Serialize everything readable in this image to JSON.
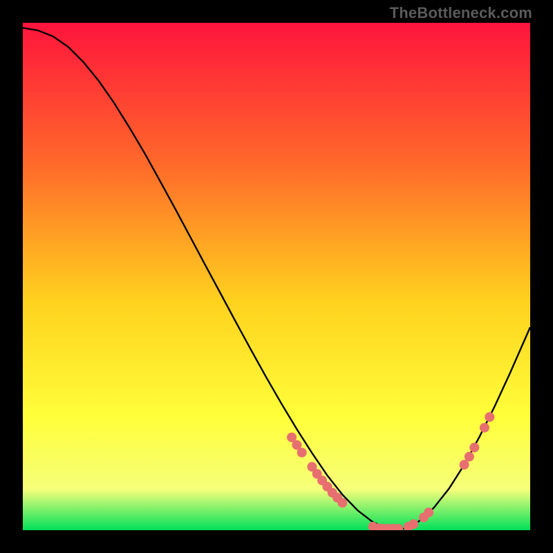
{
  "watermark": "TheBottleneck.com",
  "colors": {
    "bg": "#000000",
    "curve": "#000000",
    "marker": "#e76f6f",
    "gradient_top": "#ff143c",
    "gradient_mid_upper": "#ff6a2a",
    "gradient_mid": "#ffd21e",
    "gradient_mid_lower": "#ffff3a",
    "gradient_lower": "#f5ff7a",
    "gradient_bottom": "#00e05a"
  },
  "chart_data": {
    "type": "line",
    "title": "",
    "xlabel": "",
    "ylabel": "",
    "xlim": [
      0,
      100
    ],
    "ylim": [
      0,
      100
    ],
    "x": [
      0,
      3,
      6,
      9,
      12,
      15,
      18,
      21,
      24,
      27,
      30,
      33,
      36,
      39,
      42,
      45,
      48,
      51,
      54,
      57,
      60,
      63,
      66,
      69,
      72,
      75,
      78,
      81,
      84,
      87,
      90,
      93,
      96,
      100
    ],
    "values": [
      99,
      98.5,
      97.3,
      95.2,
      92.2,
      88.5,
      84.2,
      79.4,
      74.3,
      68.9,
      63.4,
      57.8,
      52.2,
      46.6,
      41.0,
      35.5,
      30.1,
      24.9,
      19.9,
      15.2,
      10.8,
      7.0,
      3.9,
      1.6,
      0.3,
      0.3,
      1.7,
      4.4,
      8.2,
      12.9,
      18.4,
      24.4,
      30.9,
      40.0
    ],
    "markers_x": [
      53,
      54,
      55,
      57,
      58,
      59,
      60,
      61,
      62,
      63,
      69,
      70,
      71,
      72,
      73,
      74,
      76,
      77,
      79,
      80,
      87,
      88,
      89,
      91,
      92
    ],
    "markers_values": [
      18.3,
      16.8,
      15.3,
      12.5,
      11.1,
      9.8,
      8.6,
      7.4,
      6.4,
      5.4,
      0.7,
      0.4,
      0.3,
      0.3,
      0.3,
      0.3,
      0.7,
      1.2,
      2.5,
      3.5,
      12.9,
      14.5,
      16.3,
      20.2,
      22.3
    ]
  }
}
